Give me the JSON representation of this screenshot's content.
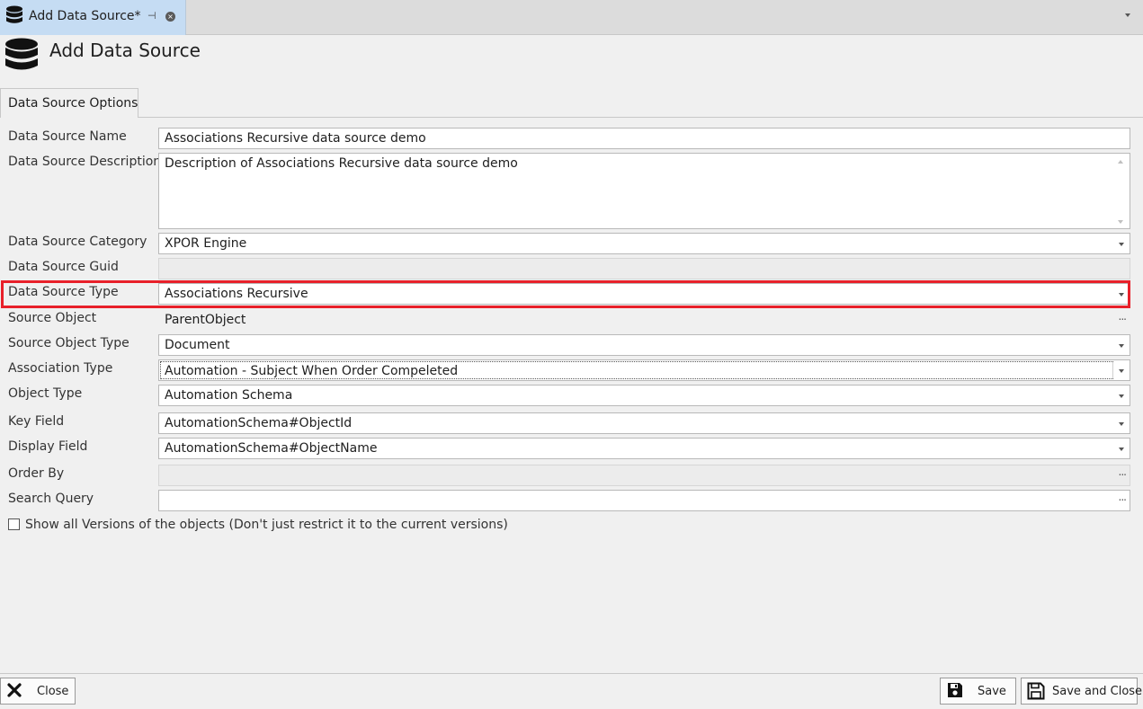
{
  "tab": {
    "title": "Add Data Source*",
    "pin_glyph": "⊣",
    "close_glyph": "×"
  },
  "header": {
    "title": "Add Data Source"
  },
  "section_tab": {
    "label": "Data Source Options"
  },
  "form": {
    "name": {
      "label": "Data Source Name",
      "value": "Associations Recursive data source demo"
    },
    "description": {
      "label": "Data Source Description",
      "value": "Description of Associations Recursive data source demo"
    },
    "category": {
      "label": "Data Source Category",
      "value": "XPOR Engine"
    },
    "guid": {
      "label": "Data Source Guid",
      "value": ""
    },
    "type": {
      "label": "Data Source Type",
      "value": "Associations Recursive"
    },
    "source_object": {
      "label": "Source Object",
      "value": "ParentObject"
    },
    "source_object_type": {
      "label": "Source Object Type",
      "value": "Document"
    },
    "association_type": {
      "label": "Association Type",
      "value": "Automation - Subject When Order Compeleted"
    },
    "object_type": {
      "label": "Object Type",
      "value": "Automation Schema"
    },
    "key_field": {
      "label": "Key Field",
      "value": "AutomationSchema#ObjectId"
    },
    "display_field": {
      "label": "Display Field",
      "value": "AutomationSchema#ObjectName"
    },
    "order_by": {
      "label": "Order By",
      "value": ""
    },
    "search_query": {
      "label": "Search Query",
      "value": ""
    },
    "show_all_versions": {
      "label": "Show all Versions of the objects (Don't just restrict it to the current versions)",
      "checked": false
    }
  },
  "ellipsis_glyph": "...",
  "footer": {
    "close_label": "Close",
    "save_label": "Save",
    "save_close_label": "Save and Close"
  },
  "colors": {
    "highlight": "#e8202a",
    "active_tab": "#c5dcf3"
  }
}
